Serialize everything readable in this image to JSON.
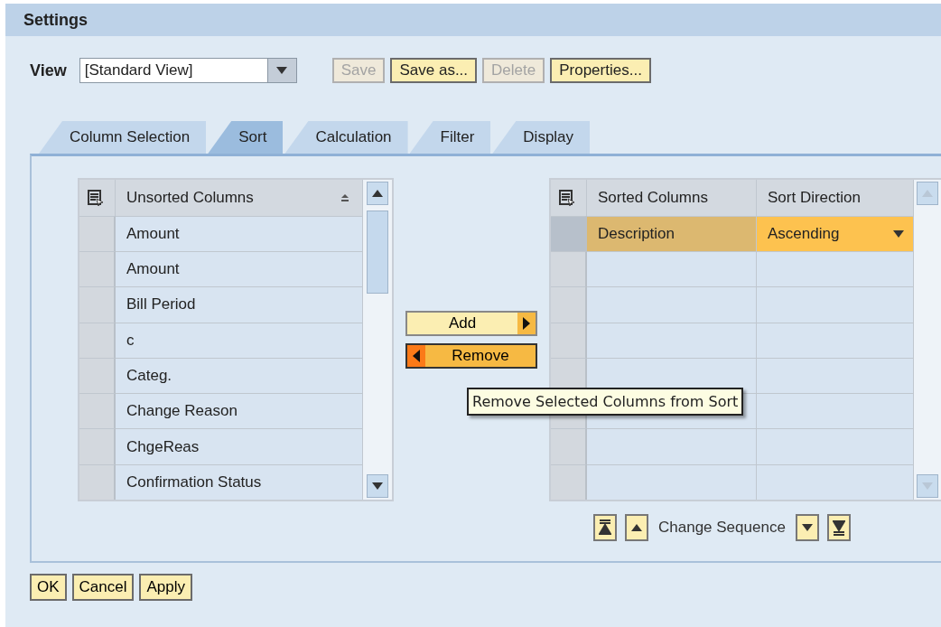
{
  "window": {
    "title": "Settings"
  },
  "view": {
    "label": "View",
    "value": "[Standard View]"
  },
  "toolbar": [
    {
      "label": "Save",
      "disabled": true
    },
    {
      "label": "Save as...",
      "disabled": false
    },
    {
      "label": "Delete",
      "disabled": true
    },
    {
      "label": "Properties...",
      "disabled": false
    }
  ],
  "tabs": [
    {
      "label": "Column Selection",
      "selected": false
    },
    {
      "label": "Sort",
      "selected": true
    },
    {
      "label": "Calculation",
      "selected": false
    },
    {
      "label": "Filter",
      "selected": false
    },
    {
      "label": "Display",
      "selected": false
    }
  ],
  "unsorted": {
    "header": "Unsorted Columns",
    "rows": [
      {
        "label": "Amount",
        "selected": false
      },
      {
        "label": "Amount",
        "selected": false
      },
      {
        "label": "Bill Period",
        "selected": false
      },
      {
        "label": "c",
        "selected": false
      },
      {
        "label": "Categ.",
        "selected": false
      },
      {
        "label": "Change Reason",
        "selected": false
      },
      {
        "label": "ChgeReas",
        "selected": false
      },
      {
        "label": "Confirmation Status",
        "selected": false
      }
    ]
  },
  "move_buttons": [
    {
      "label": "Add",
      "kind": "add",
      "hovered": false
    },
    {
      "label": "Remove",
      "kind": "remove",
      "hovered": true
    }
  ],
  "tooltip": "Remove Selected Columns from Sort",
  "sorted": {
    "columns": [
      "Sorted Columns",
      "Sort Direction"
    ],
    "rows": [
      {
        "column": "Description",
        "direction": "Ascending",
        "selected": true
      }
    ]
  },
  "sequence": {
    "label": "Change Sequence"
  },
  "footer_buttons": [
    "OK",
    "Cancel",
    "Apply"
  ]
}
